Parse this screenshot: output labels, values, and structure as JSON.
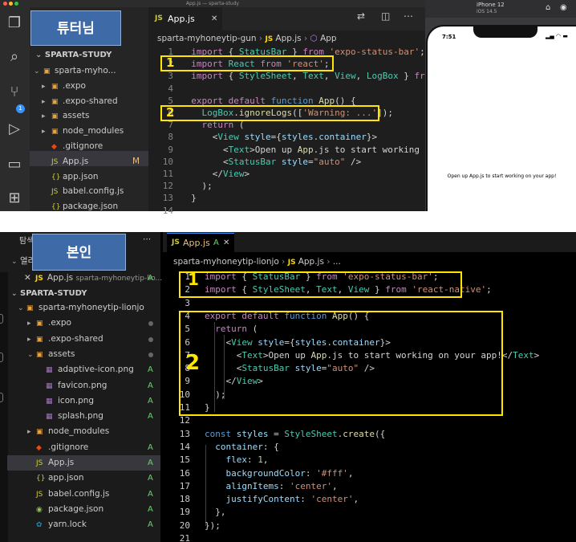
{
  "top": {
    "window_title": "App.js — sparta-study",
    "label": "튜터님",
    "explorer_header": "SPARTA-STUDY",
    "tree": [
      {
        "name": "sparta-myho...",
        "kind": "folder-open",
        "depth": 1
      },
      {
        "name": ".expo",
        "kind": "folder",
        "depth": 2
      },
      {
        "name": ".expo-shared",
        "kind": "folder",
        "depth": 2
      },
      {
        "name": "assets",
        "kind": "folder",
        "depth": 2
      },
      {
        "name": "node_modules",
        "kind": "folder",
        "depth": 2
      },
      {
        "name": ".gitignore",
        "kind": "git",
        "depth": 2
      },
      {
        "name": "App.js",
        "kind": "js",
        "depth": 2,
        "status": "M"
      },
      {
        "name": "app.json",
        "kind": "json",
        "depth": 2
      },
      {
        "name": "babel.config.js",
        "kind": "js",
        "depth": 2
      },
      {
        "name": "package.json",
        "kind": "json",
        "depth": 2
      }
    ],
    "tab_label": "App.js",
    "breadcrumb": {
      "project": "sparta-myhoneytip-gun",
      "file": "App.js",
      "symbol": "App"
    },
    "code_lines": [
      "  import { StatusBar } from 'expo-status-bar';",
      "  import React from 'react';",
      "  import { StyleSheet, Text, View, LogBox } from 'react-native';",
      "",
      "  export default function App() {",
      "    LogBox.ignoreLogs(['Warning: ...']);",
      "    return (",
      "      <View style={styles.container}>",
      "        <Text>Open up App.js to start working on your app!</Text>",
      "        <StatusBar style=\"auto\" />",
      "      </View>",
      "    );",
      "  }",
      ""
    ],
    "line_numbers": [
      "1",
      "2",
      "3",
      "4",
      "5",
      "6",
      "7",
      "8",
      "9",
      "10",
      "11",
      "12",
      "13",
      "14"
    ],
    "highlights": [
      "1",
      "2"
    ],
    "simulator": {
      "device": "iPhone 12",
      "os": "iOS 14.5",
      "time": "7:51",
      "message": "Open up App.js to start working on your app!"
    }
  },
  "bottom": {
    "sidebar_title": "탐색",
    "open_editors_label": "열려",
    "label": "본인",
    "open_file": {
      "name": "App.js",
      "path": "sparta-myhoneytip-lio...",
      "status": "A"
    },
    "explorer_header": "SPARTA-STUDY",
    "tree": [
      {
        "name": "sparta-myhoneytip-lionjo",
        "kind": "folder-open",
        "depth": 1
      },
      {
        "name": ".expo",
        "kind": "folder",
        "depth": 2,
        "status": "dot"
      },
      {
        "name": ".expo-shared",
        "kind": "folder",
        "depth": 2,
        "status": "dot"
      },
      {
        "name": "assets",
        "kind": "folder-open",
        "depth": 2,
        "status": "dot"
      },
      {
        "name": "adaptive-icon.png",
        "kind": "img",
        "depth": 3,
        "status": "A"
      },
      {
        "name": "favicon.png",
        "kind": "img",
        "depth": 3,
        "status": "A"
      },
      {
        "name": "icon.png",
        "kind": "img",
        "depth": 3,
        "status": "A"
      },
      {
        "name": "splash.png",
        "kind": "img",
        "depth": 3,
        "status": "A"
      },
      {
        "name": "node_modules",
        "kind": "folder",
        "depth": 2
      },
      {
        "name": ".gitignore",
        "kind": "git",
        "depth": 2,
        "status": "A"
      },
      {
        "name": "App.js",
        "kind": "js",
        "depth": 2,
        "status": "A"
      },
      {
        "name": "app.json",
        "kind": "json",
        "depth": 2,
        "status": "A"
      },
      {
        "name": "babel.config.js",
        "kind": "js",
        "depth": 2,
        "status": "A"
      },
      {
        "name": "package.json",
        "kind": "npm",
        "depth": 2,
        "status": "A"
      },
      {
        "name": "yarn.lock",
        "kind": "yarn",
        "depth": 2,
        "status": "A"
      }
    ],
    "tab_label": "App.js",
    "tab_status": "A",
    "breadcrumb": {
      "project": "sparta-myhoneytip-lionjo",
      "file": "App.js",
      "rest": "..."
    },
    "code_lines": [
      "import { StatusBar } from 'expo-status-bar';",
      "import { StyleSheet, Text, View } from 'react-native';",
      "",
      "export default function App() {",
      "  return (",
      "    <View style={styles.container}>",
      "      <Text>Open up App.js to start working on your app!</Text>",
      "      <StatusBar style=\"auto\" />",
      "    </View>",
      "  );",
      "}",
      "",
      "const styles = StyleSheet.create({",
      "  container: {",
      "    flex: 1,",
      "    backgroundColor: '#fff',",
      "    alignItems: 'center',",
      "    justifyContent: 'center',",
      "  },",
      "});",
      ""
    ],
    "line_numbers": [
      "1",
      "2",
      "3",
      "4",
      "5",
      "6",
      "7",
      "8",
      "9",
      "10",
      "11",
      "12",
      "13",
      "14",
      "15",
      "16",
      "17",
      "18",
      "19",
      "20",
      "21"
    ],
    "highlights": [
      "1",
      "2"
    ]
  }
}
